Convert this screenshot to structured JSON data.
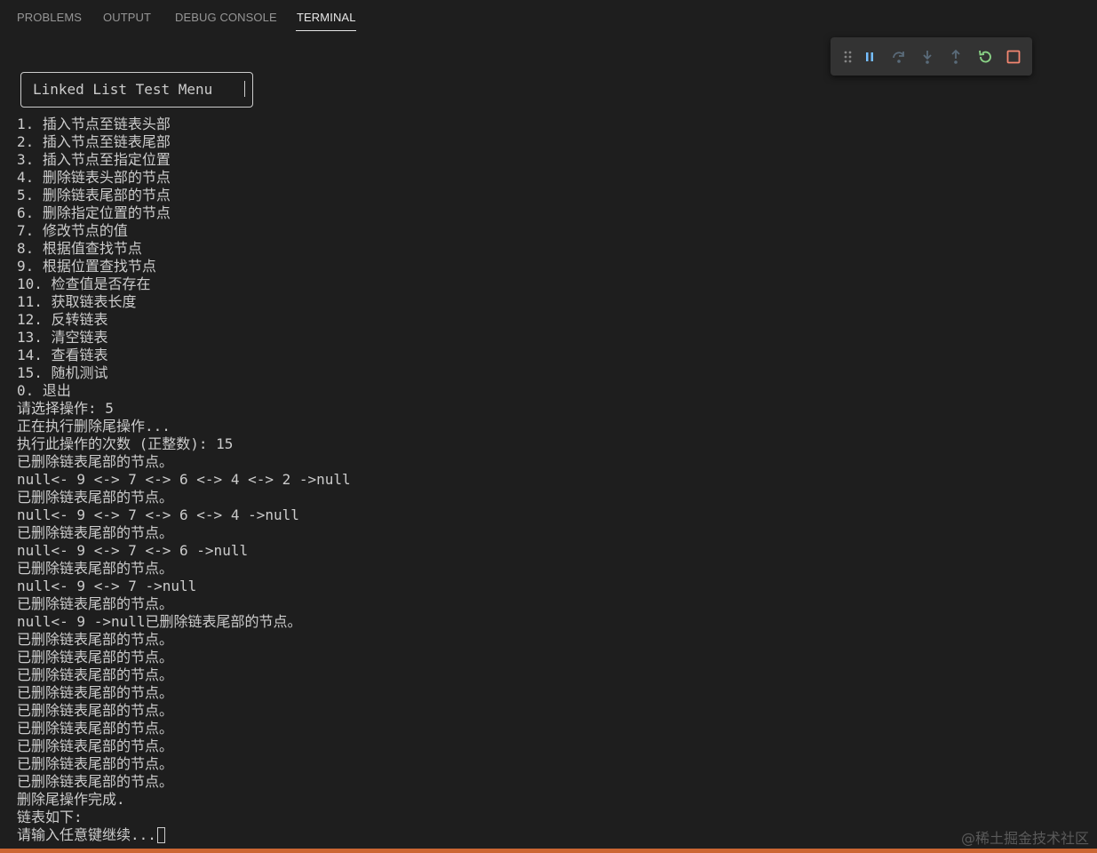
{
  "panel": {
    "tabs": [
      {
        "label": "PROBLEMS",
        "active": false
      },
      {
        "label": "OUTPUT",
        "active": false
      },
      {
        "label": "DEBUG CONSOLE",
        "active": false
      },
      {
        "label": "TERMINAL",
        "active": true
      }
    ]
  },
  "debug_toolbar": {
    "buttons": [
      {
        "icon": "drag-handle-icon",
        "color": "#858585"
      },
      {
        "icon": "pause-icon",
        "color": "#75beff"
      },
      {
        "icon": "step-over-icon",
        "color": "#5a6b7a"
      },
      {
        "icon": "step-into-icon",
        "color": "#5a6b7a"
      },
      {
        "icon": "step-out-icon",
        "color": "#5a6b7a"
      },
      {
        "icon": "restart-icon",
        "color": "#89d185"
      },
      {
        "icon": "stop-icon",
        "color": "#f48771"
      }
    ]
  },
  "terminal": {
    "menu_title": "Linked List Test Menu",
    "lines": [
      "1. 插入节点至链表头部",
      "2. 插入节点至链表尾部",
      "3. 插入节点至指定位置",
      "4. 删除链表头部的节点",
      "5. 删除链表尾部的节点",
      "6. 删除指定位置的节点",
      "7. 修改节点的值",
      "8. 根据值查找节点",
      "9. 根据位置查找节点",
      "10. 检查值是否存在",
      "11. 获取链表长度",
      "12. 反转链表",
      "13. 清空链表",
      "14. 查看链表",
      "15. 随机测试",
      "0. 退出",
      "请选择操作: 5",
      "正在执行删除尾操作...",
      "执行此操作的次数 (正整数): 15",
      "已删除链表尾部的节点。",
      "null<- 9 <-> 7 <-> 6 <-> 4 <-> 2 ->null",
      "已删除链表尾部的节点。",
      "null<- 9 <-> 7 <-> 6 <-> 4 ->null",
      "已删除链表尾部的节点。",
      "null<- 9 <-> 7 <-> 6 ->null",
      "已删除链表尾部的节点。",
      "null<- 9 <-> 7 ->null",
      "已删除链表尾部的节点。",
      "null<- 9 ->null已删除链表尾部的节点。",
      "已删除链表尾部的节点。",
      "已删除链表尾部的节点。",
      "已删除链表尾部的节点。",
      "已删除链表尾部的节点。",
      "已删除链表尾部的节点。",
      "已删除链表尾部的节点。",
      "已删除链表尾部的节点。",
      "已删除链表尾部的节点。",
      "已删除链表尾部的节点。",
      "删除尾操作完成.",
      "链表如下:"
    ],
    "prompt": "请输入任意键继续..."
  },
  "watermark": "@稀土掘金技术社区",
  "colors": {
    "background": "#1e1e1e",
    "text": "#cccccc",
    "status_strip": "#cc6633"
  }
}
